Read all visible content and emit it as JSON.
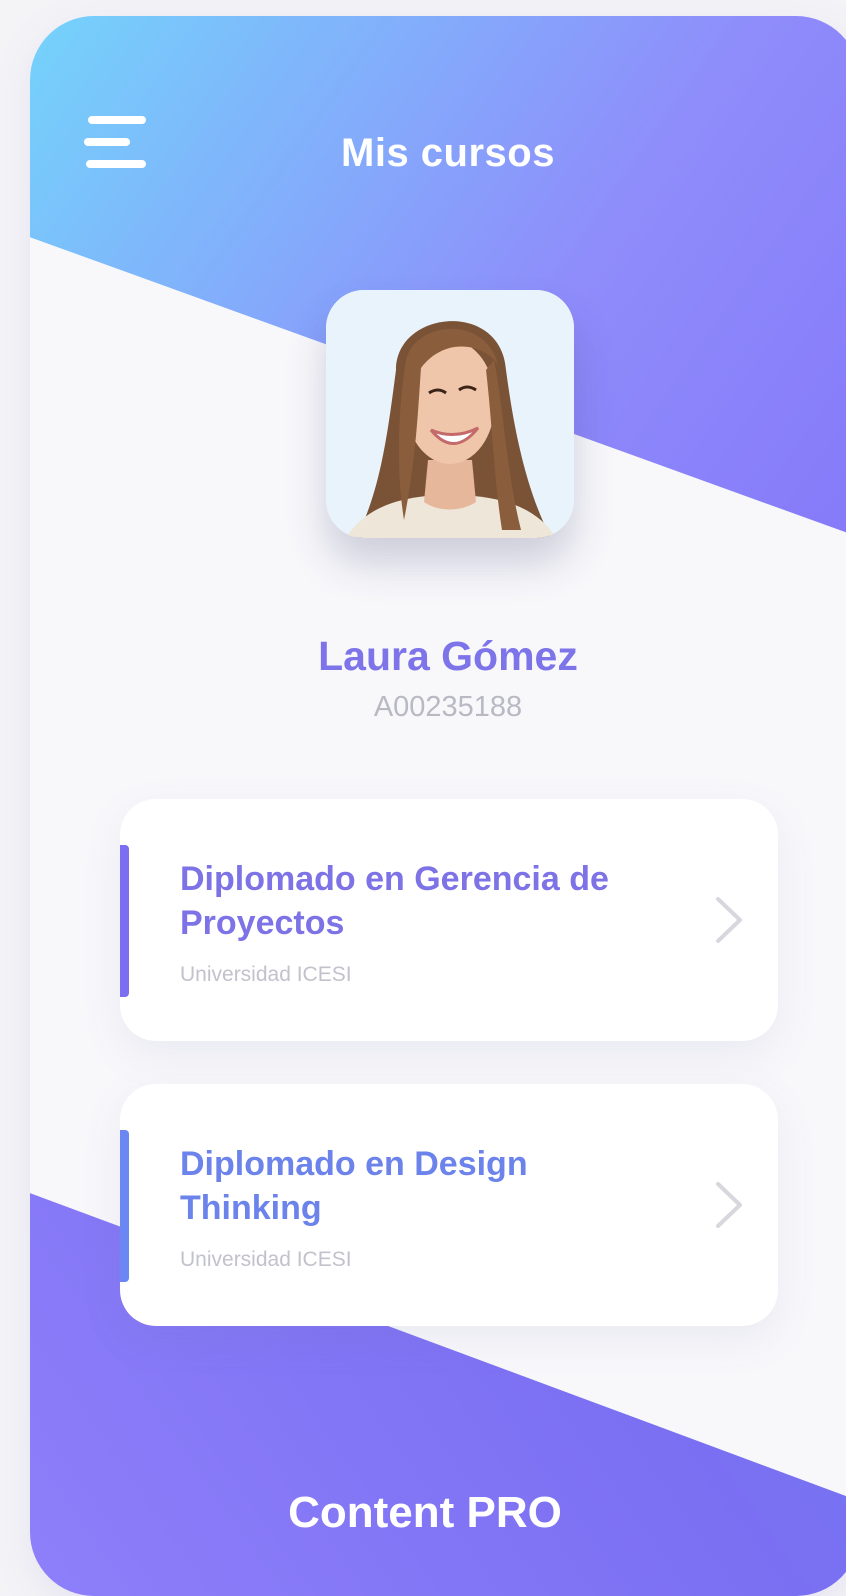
{
  "header": {
    "title": "Mis cursos",
    "menu_icon": "hamburger-menu-icon"
  },
  "profile": {
    "name": "Laura Gómez",
    "id": "A00235188",
    "avatar": "user-avatar-photo"
  },
  "courses": [
    {
      "title": "Diplomado en Gerencia de Proyectos",
      "institution": "Universidad ICESI",
      "accent_color": "#7b6ef0",
      "icon": "chevron-right-icon"
    },
    {
      "title": "Diplomado en Design Thinking",
      "institution": "Universidad ICESI",
      "accent_color": "#6b87f3",
      "icon": "chevron-right-icon"
    }
  ],
  "footer": {
    "text": "Content PRO"
  },
  "colors": {
    "gradient_top_start": "#74d3fb",
    "gradient_top_end": "#7e6cf5",
    "gradient_bottom_start": "#8e7ffa",
    "gradient_bottom_end": "#5aa2fb",
    "name_color": "#7e74e9"
  }
}
